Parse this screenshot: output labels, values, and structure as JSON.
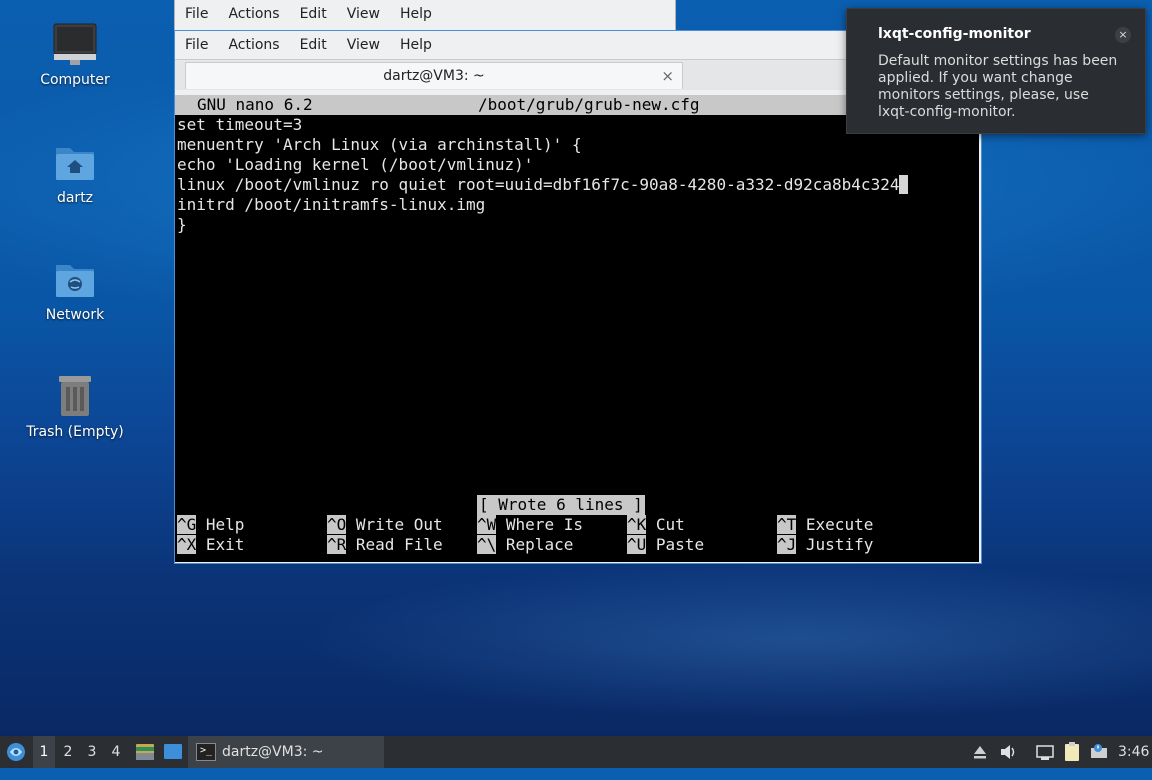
{
  "desktop": {
    "icons": [
      {
        "label": "Computer",
        "icon": "computer-icon"
      },
      {
        "label": "dartz",
        "icon": "home-folder-icon"
      },
      {
        "label": "Network",
        "icon": "network-folder-icon"
      },
      {
        "label": "Trash (Empty)",
        "icon": "trash-icon"
      }
    ]
  },
  "back_window": {
    "menu": [
      "File",
      "Actions",
      "Edit",
      "View",
      "Help"
    ]
  },
  "terminal_window": {
    "menu": [
      "File",
      "Actions",
      "Edit",
      "View",
      "Help"
    ],
    "tab_title": "dartz@VM3: ~",
    "tab_close": "×",
    "nano": {
      "version": "GNU nano 6.2",
      "filename": "/boot/grub/grub-new.cfg",
      "lines": [
        "set timeout=3",
        "menuentry 'Arch Linux (via archinstall)' {",
        "echo 'Loading kernel (/boot/vmlinuz)'",
        "linux /boot/vmlinuz ro quiet root=uuid=dbf16f7c-90a8-4280-a332-d92ca8b4c324",
        "initrd /boot/initramfs-linux.img",
        "}"
      ],
      "status_message": "[ Wrote 6 lines ]",
      "shortcuts": [
        {
          "key": "^G",
          "label": "Help"
        },
        {
          "key": "^O",
          "label": "Write Out"
        },
        {
          "key": "^W",
          "label": "Where Is"
        },
        {
          "key": "^K",
          "label": "Cut"
        },
        {
          "key": "^T",
          "label": "Execute"
        },
        {
          "key": "^X",
          "label": "Exit"
        },
        {
          "key": "^R",
          "label": "Read File"
        },
        {
          "key": "^\\",
          "label": "Replace"
        },
        {
          "key": "^U",
          "label": "Paste"
        },
        {
          "key": "^J",
          "label": "Justify"
        }
      ]
    }
  },
  "notification": {
    "title": "lxqt-config-monitor",
    "body": "Default monitor settings has been applied. If you want change monitors settings, please, use lxqt-config-monitor.",
    "close": "×"
  },
  "taskbar": {
    "workspaces": [
      "1",
      "2",
      "3",
      "4"
    ],
    "active_workspace": "1",
    "task_label": "dartz@VM3: ~",
    "clock": "3:46"
  }
}
